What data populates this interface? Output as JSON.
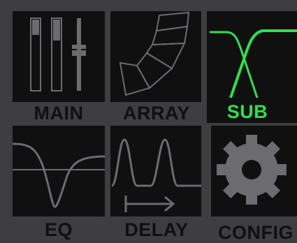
{
  "tiles": {
    "main": {
      "label": "MAIN"
    },
    "array": {
      "label": "ARRAY"
    },
    "sub": {
      "label": "SUB"
    },
    "eq": {
      "label": "EQ"
    },
    "delay": {
      "label": "DELAY"
    },
    "config": {
      "label": "CONFIG"
    }
  },
  "selected_tile": "sub",
  "colors": {
    "background": "#3e3e41",
    "panel": "#101011",
    "icon_gray": "#6b6b70",
    "active_green": "#2ee04f",
    "label_dark": "#101012"
  },
  "icons": {
    "main": "faders-icon",
    "array": "line-array-icon",
    "sub": "crossover-filter-icon",
    "eq": "eq-curve-icon",
    "delay": "delay-wave-icon",
    "config": "gear-icon"
  }
}
